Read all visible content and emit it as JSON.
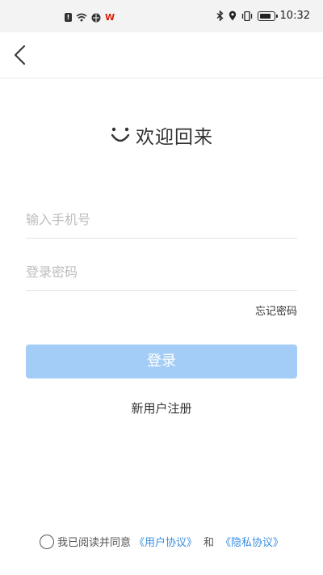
{
  "status_bar": {
    "time": "10:32",
    "left_icons": [
      "notification-badge-icon",
      "wifi-signal-icon",
      "globe-icon",
      "wps-icon"
    ],
    "right_icons": [
      "bluetooth-icon",
      "location-icon",
      "vibrate-icon",
      "battery-icon"
    ]
  },
  "nav": {
    "back_icon": "chevron-left-icon"
  },
  "header": {
    "title": "欢迎回来",
    "logo_icon": "smile-icon"
  },
  "form": {
    "phone_placeholder": "输入手机号",
    "phone_value": "",
    "password_placeholder": "登录密码",
    "password_value": "",
    "forgot_label": "忘记密码",
    "login_label": "登录",
    "register_label": "新用户注册"
  },
  "agreement": {
    "prefix": "我已阅读并同意",
    "user_agreement": "《用户协议》",
    "and": "和",
    "privacy_policy": "《隐私协议》"
  },
  "colors": {
    "login_button": "#a3cdf6",
    "link": "#3b8fe0",
    "status_bar_bg": "#f3f3f3"
  }
}
